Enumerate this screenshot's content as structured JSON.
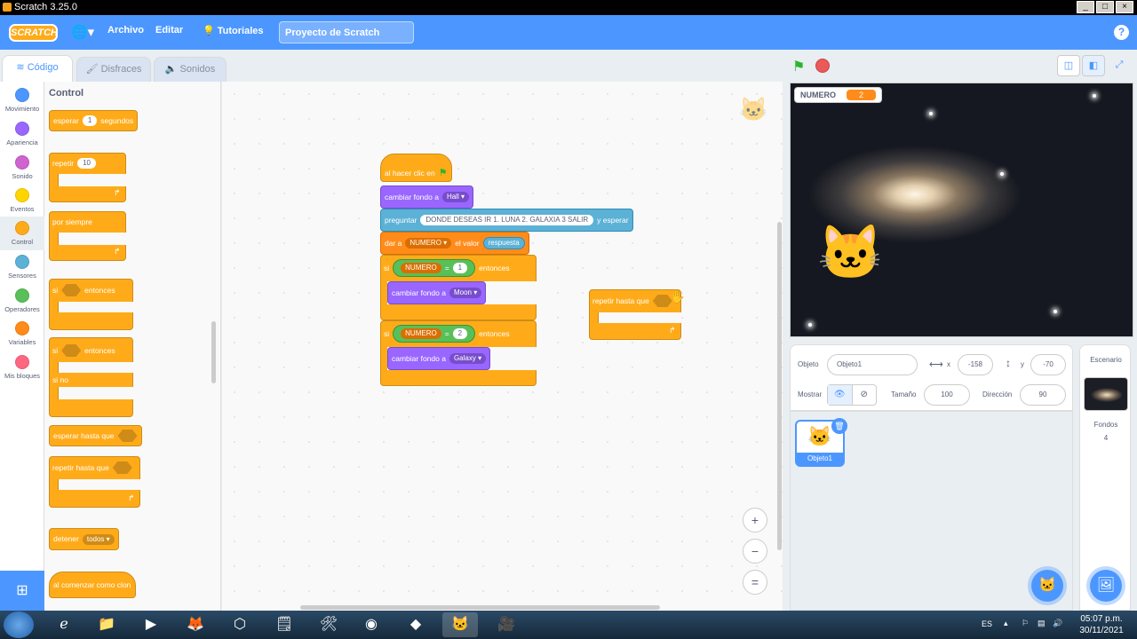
{
  "window": {
    "title": "Scratch 3.25.0"
  },
  "menubar": {
    "logo": "SCRATCH",
    "items": [
      "Archivo",
      "Editar",
      "Tutoriales"
    ],
    "project_title": "Proyecto de Scratch",
    "help": "?"
  },
  "tabs": [
    "Código",
    "Disfraces",
    "Sonidos"
  ],
  "categories": [
    {
      "label": "Movimiento",
      "color": "#4c97ff"
    },
    {
      "label": "Apariencia",
      "color": "#9966ff"
    },
    {
      "label": "Sonido",
      "color": "#cf63cf"
    },
    {
      "label": "Eventos",
      "color": "#ffd500"
    },
    {
      "label": "Control",
      "color": "#ffab19"
    },
    {
      "label": "Sensores",
      "color": "#5cb1d6"
    },
    {
      "label": "Operadores",
      "color": "#59c059"
    },
    {
      "label": "Variables",
      "color": "#ff8c1a"
    },
    {
      "label": "Mis bloques",
      "color": "#ff6680"
    }
  ],
  "palette": {
    "title": "Control",
    "wait": {
      "pre": "esperar",
      "val": "1",
      "post": "segundos"
    },
    "repeat": {
      "pre": "repetir",
      "val": "10"
    },
    "forever": "por siempre",
    "if_then": {
      "pre": "si",
      "post": "entonces"
    },
    "if_else": {
      "pre": "si",
      "post": "entonces",
      "else": "si no"
    },
    "wait_until": "esperar hasta que",
    "repeat_until": "repetir hasta que",
    "stop": {
      "pre": "detener",
      "val": "todos"
    },
    "clone_start": "al comenzar como clon"
  },
  "script": {
    "hat": "al hacer clic en",
    "switch1": {
      "label": "cambiar fondo a",
      "val": "Hall"
    },
    "ask": {
      "label": "preguntar",
      "val": "DONDE DESEAS IR 1. LUNA 2. GALAXIA 3 SALIR",
      "post": "y esperar"
    },
    "set": {
      "label": "dar a",
      "var": "NUMERO",
      "mid": "el valor",
      "val": "respuesta"
    },
    "if1": {
      "pre": "si",
      "var": "NUMERO",
      "op": "=",
      "val": "1",
      "post": "entonces"
    },
    "switch2": {
      "label": "cambiar fondo a",
      "val": "Moon"
    },
    "if2": {
      "pre": "si",
      "var": "NUMERO",
      "op": "=",
      "val": "2",
      "post": "entonces"
    },
    "switch3": {
      "label": "cambiar fondo a",
      "val": "Galaxy"
    },
    "loose": "repetir hasta que"
  },
  "zoom": {
    "in": "+",
    "out": "−",
    "reset": "="
  },
  "stage": {
    "monitor_name": "NUMERO",
    "monitor_value": "2"
  },
  "sprite_info": {
    "sprite_label": "Objeto",
    "sprite_name": "Objeto1",
    "x_label": "x",
    "x": "-158",
    "y_label": "y",
    "y": "-70",
    "show_label": "Mostrar",
    "size_label": "Tamaño",
    "size": "100",
    "direction_label": "Dirección",
    "direction": "90"
  },
  "sprites": [
    {
      "name": "Objeto1"
    }
  ],
  "stage_pane": {
    "title": "Escenario",
    "backdrops_label": "Fondos",
    "backdrops_count": "4"
  },
  "taskbar": {
    "lang": "ES",
    "time": "05:07 p.m.",
    "date": "30/11/2021"
  }
}
